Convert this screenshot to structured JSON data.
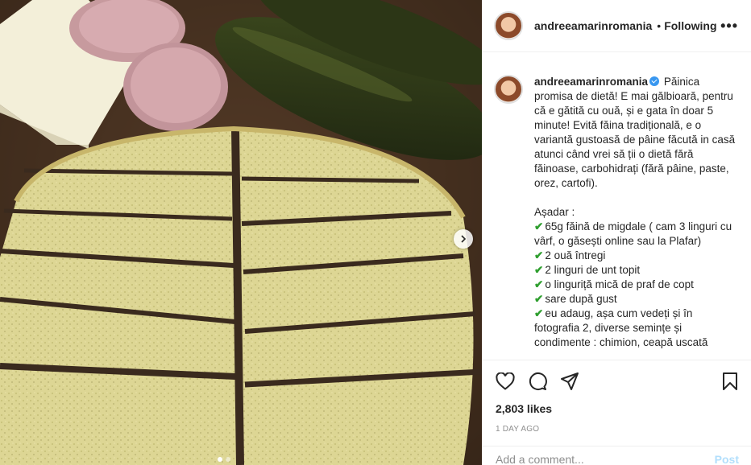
{
  "post": {
    "username": "andreeamarinromania",
    "follow_status": "Following",
    "more_icon": "more-options-icon",
    "caption": {
      "intro": "Păinica promisa de dietă! E mai gălbioară, pentru că e gătită cu ouă, și e gata în doar 5 minute! Evită făina tradițională, e o variantă gustoasă de pâine făcută in casă atunci când vrei să ții o dietă fără făinoase, carbohidrați (fără pâine, paste, orez, cartofi).",
      "heading": "Așadar :",
      "items": [
        "65g făină de migdale ( cam 3 linguri cu vârf, o găsești online sau la Plafar)",
        "2 ouă întregi",
        "2 linguri de unt topit",
        "o linguriță mică de praf de copt",
        "sare după gust",
        "eu adaug, așa cum vedeți și în fotografia 2, diverse semințe și condimente : chimion, ceapă uscată"
      ]
    },
    "likes": "2,803 likes",
    "time": "1 DAY AGO",
    "comment_placeholder": "Add a comment...",
    "post_label": "Post",
    "colors": {
      "accent": "#3897f0",
      "post_disabled": "#b2dffc",
      "check": "#2e9e2e"
    }
  }
}
